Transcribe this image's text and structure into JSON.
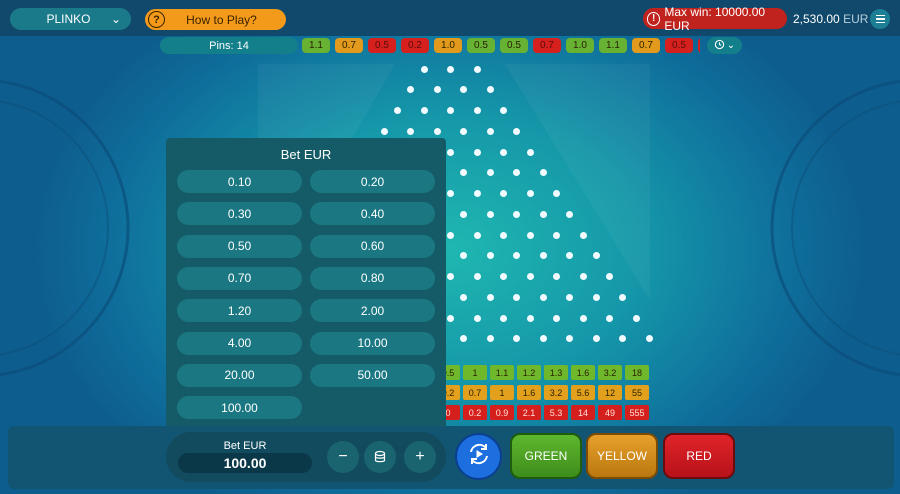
{
  "header": {
    "game_name": "PLINKO",
    "how_to_play": "How to Play?",
    "max_win": "Max win: 10000.00 EUR",
    "balance": "2,530.00",
    "currency": "EUR"
  },
  "pins_label": "Pins: 14",
  "history": [
    {
      "value": "1.1",
      "color": "green"
    },
    {
      "value": "0.7",
      "color": "yellow"
    },
    {
      "value": "0.5",
      "color": "red"
    },
    {
      "value": "0.2",
      "color": "red"
    },
    {
      "value": "1.0",
      "color": "yellow"
    },
    {
      "value": "0.5",
      "color": "green"
    },
    {
      "value": "0.5",
      "color": "green"
    },
    {
      "value": "0.7",
      "color": "red"
    },
    {
      "value": "1.0",
      "color": "green"
    },
    {
      "value": "1.1",
      "color": "green"
    },
    {
      "value": "0.7",
      "color": "yellow"
    },
    {
      "value": "0.5",
      "color": "red"
    },
    {
      "value": "",
      "color": "red"
    }
  ],
  "multipliers": {
    "green": [
      "0.5",
      "1",
      "1.1",
      "1.2",
      "1.3",
      "1.6",
      "3.2",
      "18"
    ],
    "yellow": [
      "0.2",
      "0.7",
      "1",
      "1.6",
      "3.2",
      "5.6",
      "12",
      "55"
    ],
    "red": [
      "0",
      "0.2",
      "0.9",
      "2.1",
      "5.3",
      "14",
      "49",
      "555"
    ]
  },
  "bet_panel": {
    "title": "Bet EUR",
    "options": [
      "0.10",
      "0.20",
      "0.30",
      "0.40",
      "0.50",
      "0.60",
      "0.70",
      "0.80",
      "1.20",
      "2.00",
      "4.00",
      "10.00",
      "20.00",
      "50.00",
      "100.00"
    ]
  },
  "bet_control": {
    "label": "Bet EUR",
    "value": "100.00",
    "minus": "−",
    "plus": "+"
  },
  "buttons": {
    "green": "GREEN",
    "yellow": "YELLOW",
    "red": "RED"
  },
  "icons": {
    "help": "question-mark-icon",
    "warning": "warning-icon",
    "menu": "hamburger-menu-icon",
    "history": "history-clock-icon",
    "coins": "coin-stack-icon",
    "autoplay": "autoplay-icon"
  }
}
